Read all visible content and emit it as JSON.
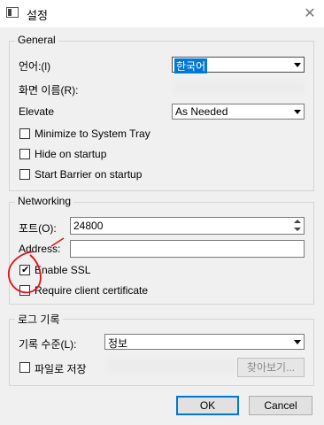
{
  "window": {
    "title": "설정",
    "close_glyph": "✕"
  },
  "general": {
    "group_title": "General",
    "language_label": "언어:(l)",
    "language_value": "한국어",
    "screen_name_label": "화면 이름(R):",
    "elevate_label": "Elevate",
    "elevate_value": "As Needed",
    "minimize_label": "Minimize to System Tray",
    "hide_label": "Hide on startup",
    "start_label": "Start Barrier on startup"
  },
  "networking": {
    "group_title": "Networking",
    "port_label": "포트(O):",
    "port_value": "24800",
    "address_label": "Address:",
    "address_value": "",
    "enable_ssl_label": "Enable SSL",
    "enable_ssl_checked": true,
    "require_cert_label": "Require client certificate"
  },
  "logging": {
    "group_title": "로그 기록",
    "level_label": "기록 수준(L):",
    "level_value": "정보",
    "log_to_file_label": "파일로 저장",
    "browse_label": "찾아보기..."
  },
  "footer": {
    "ok_label": "OK",
    "cancel_label": "Cancel"
  },
  "colors": {
    "selection": "#0078d7",
    "annotation": "#e0121b"
  }
}
